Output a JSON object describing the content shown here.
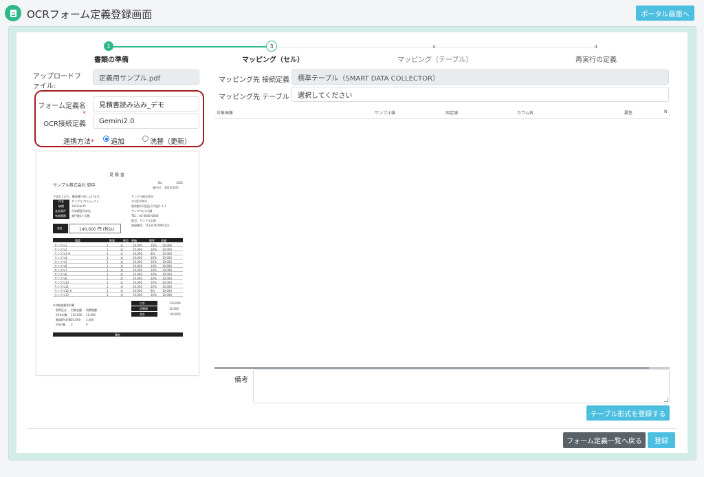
{
  "app": {
    "title": "OCRフォーム定義登録画面",
    "portal_button": "ポータル画面へ"
  },
  "steps": [
    {
      "num": "1",
      "label": "書類の準備",
      "state": "done"
    },
    {
      "num": "2",
      "label": "マッピング（セル）",
      "state": "active"
    },
    {
      "num": "3",
      "label": "マッピング（テーブル）",
      "state": "pending"
    },
    {
      "num": "4",
      "label": "再実行の定義",
      "state": "pending"
    }
  ],
  "form": {
    "upload_label": "アップロードファイル:",
    "upload_value": "定義用サンプル.pdf",
    "form_name_label": "フォーム定義名",
    "form_name_value": "見積書読み込み_デモ",
    "ocr_label": "OCR接続定義",
    "ocr_value": "Gemini2.0",
    "link_method_label": "連携方法",
    "link_options": [
      "追加",
      "洗替（更新）"
    ],
    "required_mark": "*"
  },
  "mapping": {
    "conn_label": "マッピング先 接続定義",
    "conn_value": "標準テーブル（SMART DATA COLLECTOR）",
    "table_label": "マッピング先 テーブル",
    "table_placeholder": "選択してください",
    "columns": [
      "対象画像",
      "サンプル値",
      "固定値",
      "カラム名",
      "属性",
      "N"
    ]
  },
  "remarks_label": "備考",
  "buttons": {
    "register_table": "テーブル形式を登録する",
    "back": "フォーム定義一覧へ戻る",
    "register": "登録"
  },
  "preview": {
    "title": "見 積 書",
    "recipient": "サンプル株式会社 御中",
    "no_label": "No.",
    "no_value": "1001",
    "date_label": "発行日",
    "date_value": "2022/4/30",
    "intro": "下記のとおり、御見積り申し上げます。",
    "info_labels": [
      "件名",
      "納期",
      "支払条件",
      "有効期限"
    ],
    "info_values": [
      "サンプルプロジェクト",
      "2022/4/30",
      "月末締翌月末払",
      "発行後3ヶ月間"
    ],
    "company_lines": [
      "サンプル株式会社",
      "〒100-0001",
      "東京都千代田区千代田1-1-1",
      "サンプルビル1階",
      "TEL：03-0000-0000",
      "担当：サンプル太郎",
      "登録番号：T1234567890123"
    ],
    "total_label": "合計",
    "total_value": "140,600 円 (税込)",
    "table_headers": [
      "摘要",
      "数量",
      "単位",
      "単価",
      "税率",
      "金額"
    ],
    "rows": [
      [
        "サンプル1",
        "1",
        "式",
        "10,000",
        "10%",
        "10,000"
      ],
      [
        "サンプル2",
        "1",
        "式",
        "10,000",
        "10%",
        "10,000"
      ],
      [
        "サンプル3 ※",
        "1",
        "式",
        "10,000",
        "8%",
        "10,000"
      ],
      [
        "サンプル4",
        "1",
        "式",
        "10,000",
        "10%",
        "10,000"
      ],
      [
        "サンプル5",
        "1",
        "式",
        "10,000",
        "10%",
        "10,000"
      ],
      [
        "サンプル6",
        "1",
        "式",
        "10,000",
        "10%",
        "10,000"
      ],
      [
        "サンプル7",
        "1",
        "式",
        "10,000",
        "10%",
        "10,000"
      ],
      [
        "サンプル8",
        "1",
        "式",
        "10,000",
        "10%",
        "10,000"
      ],
      [
        "サンプル9",
        "1",
        "式",
        "10,000",
        "10%",
        "10,000"
      ],
      [
        "サンプル10",
        "1",
        "式",
        "10,000",
        "10%",
        "10,000"
      ],
      [
        "サンプル11",
        "1",
        "式",
        "10,000",
        "10%",
        "10,000"
      ],
      [
        "サンプル12 ※",
        "1",
        "式",
        "10,000",
        "8%",
        "10,000"
      ],
      [
        "サンプル13",
        "1",
        "式",
        "10,000",
        "10%",
        "10,000"
      ]
    ],
    "tax_note": "※は軽減税率対象",
    "tax_table": [
      [
        "税率区分",
        "対象金額",
        "消費税額"
      ],
      [
        "10%対象",
        "110,000",
        "11,000"
      ],
      [
        "軽減8%対象",
        "20,000",
        "1,600"
      ],
      [
        "0%対象",
        "0",
        "0"
      ]
    ],
    "summary": [
      [
        "小計",
        "130,000"
      ],
      [
        "消費税",
        "12,600"
      ],
      [
        "合計",
        "140,600"
      ]
    ],
    "footer": "備考"
  }
}
